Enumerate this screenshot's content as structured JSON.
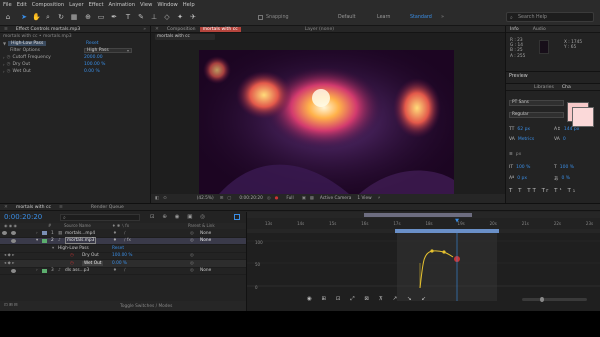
{
  "menu": [
    "File",
    "Edit",
    "Composition",
    "Layer",
    "Effect",
    "Animation",
    "View",
    "Window",
    "Help"
  ],
  "toolbar": {
    "snapping": "Snapping",
    "workspaces": [
      "Default",
      "Learn",
      "Standard"
    ],
    "active_workspace": "Standard",
    "search_placeholder": "Search Help"
  },
  "project_panel": {
    "tab": "Effect Controls mortals.mp3",
    "path": "mortals with cc • mortals.mp3",
    "effect": "High-Low Pass",
    "reset": "Reset",
    "filter_label": "Filter Options",
    "filter_value": "High Pass",
    "props": [
      {
        "name": "Cutoff Frequency",
        "value": "2000.00"
      },
      {
        "name": "Dry Out",
        "value": "100.00 %"
      },
      {
        "name": "Wet Out",
        "value": "0.00 %"
      }
    ]
  },
  "composition": {
    "tab": "Composition",
    "comp_name": "mortals with cc",
    "layer_tab": "Layer (none)",
    "zoom": "(42.5%)",
    "time": "0:00:20:20",
    "resolution": "Full",
    "camera": "Active Camera",
    "views": "1 View"
  },
  "info_panel": {
    "tabs": [
      "Info",
      "Audio"
    ],
    "r": "R : 23",
    "g": "G : 14",
    "b": "B : 25",
    "a": "A : 255",
    "x": "X : 1745",
    "y": "Y : 65"
  },
  "right_panel": {
    "preview": "Preview",
    "tabs": [
      "Libraries",
      "Cha"
    ],
    "font": "PT Sans",
    "style": "Regular",
    "size": "62 px",
    "leading": "144 px",
    "kerning": "Metrics",
    "tracking": "0",
    "stroke": "px",
    "scale_v": "100 %",
    "scale_h": "100 %",
    "baseline": "0 px",
    "tsume": "0 %"
  },
  "timeline": {
    "comp_tab": "mortals with cc",
    "render_tab": "Render Queue",
    "timecode": "0:00:20:20",
    "columns": {
      "source": "Source Name",
      "parent": "Parent & Link"
    },
    "layers": [
      {
        "num": "1",
        "name": "mortals...mp4",
        "parent": "None"
      },
      {
        "num": "2",
        "name": "mortals.mp3",
        "parent": "None"
      },
      {
        "num": "3",
        "name": "dls ass...p3",
        "parent": "None"
      }
    ],
    "effect_name": "High-Low Pass",
    "effect_reset": "Reset",
    "sub_props": [
      {
        "name": "Dry Out",
        "value": "100.00 %"
      },
      {
        "name": "Wet Out",
        "value": "0.00 %"
      }
    ],
    "toggle_label": "Toggle Switches / Modes",
    "ruler": [
      "13s",
      "14s",
      "15s",
      "16s",
      "17s",
      "18s",
      "19s",
      "20s",
      "21s",
      "22s",
      "23s"
    ],
    "graph_labels": [
      "100",
      "50",
      "0"
    ],
    "curve_color": "#e6c230",
    "playhead_color": "#3a8ee6"
  }
}
